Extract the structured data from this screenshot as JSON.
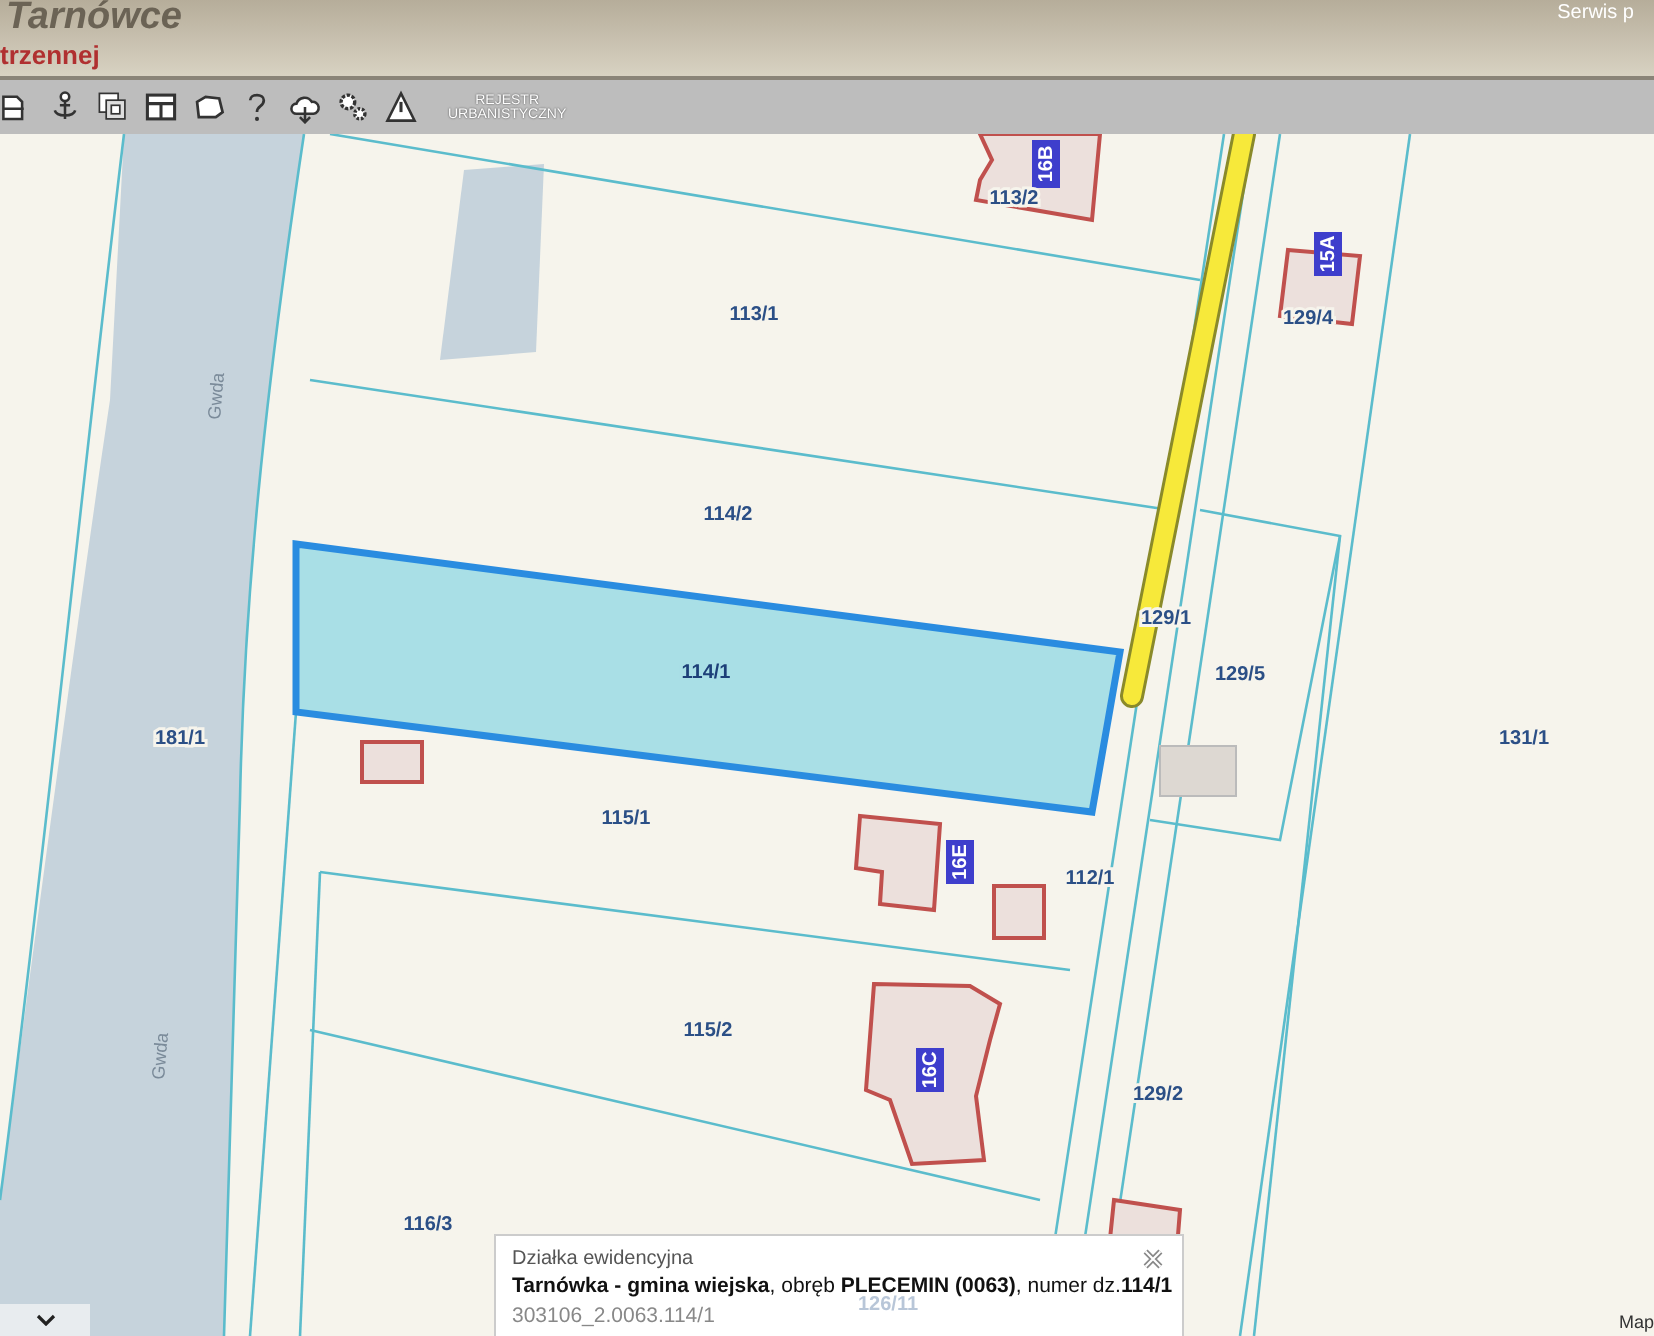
{
  "header": {
    "title": "Tarnówce",
    "subtitle": "trzennej",
    "corner_text": "Serwis p"
  },
  "toolbar": {
    "tools": [
      {
        "kind": "document"
      },
      {
        "kind": "anchor"
      },
      {
        "kind": "layers"
      },
      {
        "kind": "layout"
      },
      {
        "kind": "shape"
      },
      {
        "kind": "help"
      },
      {
        "kind": "cloud"
      },
      {
        "kind": "settings"
      },
      {
        "kind": "warning"
      }
    ],
    "register_label_lines": [
      "REJESTR",
      "URBANISTYCZNY"
    ]
  },
  "map": {
    "river_labels": [
      "Gwda",
      "Gwda"
    ],
    "parcels": [
      {
        "label": "113/2",
        "selected": false
      },
      {
        "label": "113/1",
        "selected": false
      },
      {
        "label": "129/4",
        "selected": false
      },
      {
        "label": "114/2",
        "selected": false
      },
      {
        "label": "129/1",
        "selected": false
      },
      {
        "label": "114/1",
        "selected": true
      },
      {
        "label": "129/5",
        "selected": false
      },
      {
        "label": "181/1",
        "selected": false
      },
      {
        "label": "131/1",
        "selected": false
      },
      {
        "label": "115/1",
        "selected": false
      },
      {
        "label": "112/1",
        "selected": false
      },
      {
        "label": "115/2",
        "selected": false
      },
      {
        "label": "129/2",
        "selected": false
      },
      {
        "label": "116/3",
        "selected": false
      },
      {
        "label": "126/11",
        "selected": false
      }
    ],
    "building_numbers": [
      "16B",
      "15A",
      "16E",
      "16C"
    ],
    "attribution": "Map"
  },
  "popup": {
    "heading": "Działka ewidencyjna",
    "description": "**Tarnówka - gmina wiejska**, obręb **PLECEMIN (0063)**, numer dz.**114/1**",
    "identifier": "303106_2.0063.114/1"
  }
}
